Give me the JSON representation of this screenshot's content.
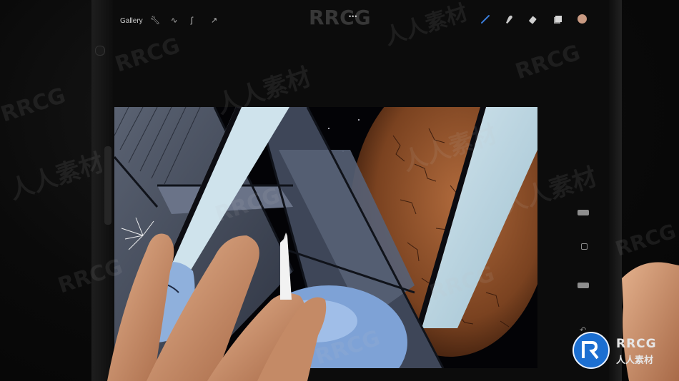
{
  "toolbar": {
    "gallery_label": "Gallery",
    "more_label": "•••",
    "left_tools": [
      "wrench-icon",
      "magic-wand-icon",
      "selection-icon",
      "transform-arrow-icon"
    ],
    "right_tools": [
      "brush-icon",
      "smudge-icon",
      "eraser-icon",
      "layers-icon",
      "color-swatch"
    ],
    "active_color": "#c99a82",
    "accent_color": "#3a7bd5"
  },
  "watermark": {
    "brand": "RRCG",
    "cn": "人人素材"
  },
  "logo": {
    "brand": "RRCG",
    "cn": "人人素材",
    "badge_color": "#1c6fd1"
  }
}
